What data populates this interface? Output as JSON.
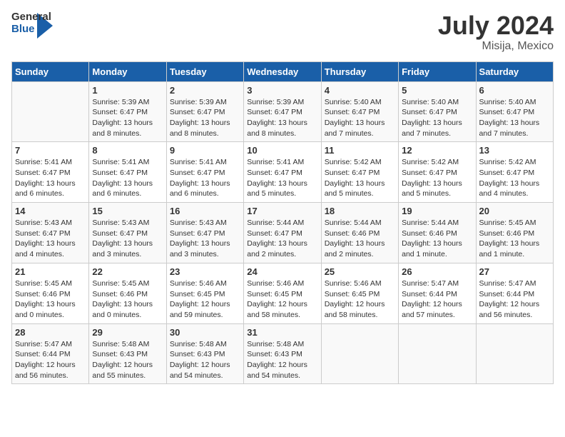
{
  "header": {
    "logo_line1": "General",
    "logo_line2": "Blue",
    "month_year": "July 2024",
    "location": "Misija, Mexico"
  },
  "days_of_week": [
    "Sunday",
    "Monday",
    "Tuesday",
    "Wednesday",
    "Thursday",
    "Friday",
    "Saturday"
  ],
  "weeks": [
    [
      {
        "day": "",
        "info": ""
      },
      {
        "day": "1",
        "info": "Sunrise: 5:39 AM\nSunset: 6:47 PM\nDaylight: 13 hours\nand 8 minutes."
      },
      {
        "day": "2",
        "info": "Sunrise: 5:39 AM\nSunset: 6:47 PM\nDaylight: 13 hours\nand 8 minutes."
      },
      {
        "day": "3",
        "info": "Sunrise: 5:39 AM\nSunset: 6:47 PM\nDaylight: 13 hours\nand 8 minutes."
      },
      {
        "day": "4",
        "info": "Sunrise: 5:40 AM\nSunset: 6:47 PM\nDaylight: 13 hours\nand 7 minutes."
      },
      {
        "day": "5",
        "info": "Sunrise: 5:40 AM\nSunset: 6:47 PM\nDaylight: 13 hours\nand 7 minutes."
      },
      {
        "day": "6",
        "info": "Sunrise: 5:40 AM\nSunset: 6:47 PM\nDaylight: 13 hours\nand 7 minutes."
      }
    ],
    [
      {
        "day": "7",
        "info": "Sunrise: 5:41 AM\nSunset: 6:47 PM\nDaylight: 13 hours\nand 6 minutes."
      },
      {
        "day": "8",
        "info": "Sunrise: 5:41 AM\nSunset: 6:47 PM\nDaylight: 13 hours\nand 6 minutes."
      },
      {
        "day": "9",
        "info": "Sunrise: 5:41 AM\nSunset: 6:47 PM\nDaylight: 13 hours\nand 6 minutes."
      },
      {
        "day": "10",
        "info": "Sunrise: 5:41 AM\nSunset: 6:47 PM\nDaylight: 13 hours\nand 5 minutes."
      },
      {
        "day": "11",
        "info": "Sunrise: 5:42 AM\nSunset: 6:47 PM\nDaylight: 13 hours\nand 5 minutes."
      },
      {
        "day": "12",
        "info": "Sunrise: 5:42 AM\nSunset: 6:47 PM\nDaylight: 13 hours\nand 5 minutes."
      },
      {
        "day": "13",
        "info": "Sunrise: 5:42 AM\nSunset: 6:47 PM\nDaylight: 13 hours\nand 4 minutes."
      }
    ],
    [
      {
        "day": "14",
        "info": "Sunrise: 5:43 AM\nSunset: 6:47 PM\nDaylight: 13 hours\nand 4 minutes."
      },
      {
        "day": "15",
        "info": "Sunrise: 5:43 AM\nSunset: 6:47 PM\nDaylight: 13 hours\nand 3 minutes."
      },
      {
        "day": "16",
        "info": "Sunrise: 5:43 AM\nSunset: 6:47 PM\nDaylight: 13 hours\nand 3 minutes."
      },
      {
        "day": "17",
        "info": "Sunrise: 5:44 AM\nSunset: 6:47 PM\nDaylight: 13 hours\nand 2 minutes."
      },
      {
        "day": "18",
        "info": "Sunrise: 5:44 AM\nSunset: 6:46 PM\nDaylight: 13 hours\nand 2 minutes."
      },
      {
        "day": "19",
        "info": "Sunrise: 5:44 AM\nSunset: 6:46 PM\nDaylight: 13 hours\nand 1 minute."
      },
      {
        "day": "20",
        "info": "Sunrise: 5:45 AM\nSunset: 6:46 PM\nDaylight: 13 hours\nand 1 minute."
      }
    ],
    [
      {
        "day": "21",
        "info": "Sunrise: 5:45 AM\nSunset: 6:46 PM\nDaylight: 13 hours\nand 0 minutes."
      },
      {
        "day": "22",
        "info": "Sunrise: 5:45 AM\nSunset: 6:46 PM\nDaylight: 13 hours\nand 0 minutes."
      },
      {
        "day": "23",
        "info": "Sunrise: 5:46 AM\nSunset: 6:45 PM\nDaylight: 12 hours\nand 59 minutes."
      },
      {
        "day": "24",
        "info": "Sunrise: 5:46 AM\nSunset: 6:45 PM\nDaylight: 12 hours\nand 58 minutes."
      },
      {
        "day": "25",
        "info": "Sunrise: 5:46 AM\nSunset: 6:45 PM\nDaylight: 12 hours\nand 58 minutes."
      },
      {
        "day": "26",
        "info": "Sunrise: 5:47 AM\nSunset: 6:44 PM\nDaylight: 12 hours\nand 57 minutes."
      },
      {
        "day": "27",
        "info": "Sunrise: 5:47 AM\nSunset: 6:44 PM\nDaylight: 12 hours\nand 56 minutes."
      }
    ],
    [
      {
        "day": "28",
        "info": "Sunrise: 5:47 AM\nSunset: 6:44 PM\nDaylight: 12 hours\nand 56 minutes."
      },
      {
        "day": "29",
        "info": "Sunrise: 5:48 AM\nSunset: 6:43 PM\nDaylight: 12 hours\nand 55 minutes."
      },
      {
        "day": "30",
        "info": "Sunrise: 5:48 AM\nSunset: 6:43 PM\nDaylight: 12 hours\nand 54 minutes."
      },
      {
        "day": "31",
        "info": "Sunrise: 5:48 AM\nSunset: 6:43 PM\nDaylight: 12 hours\nand 54 minutes."
      },
      {
        "day": "",
        "info": ""
      },
      {
        "day": "",
        "info": ""
      },
      {
        "day": "",
        "info": ""
      }
    ]
  ]
}
